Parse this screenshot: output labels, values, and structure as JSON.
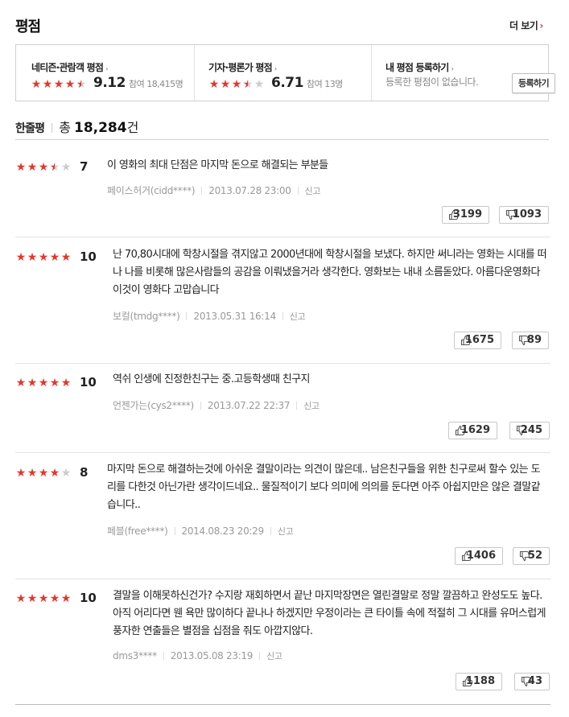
{
  "header": {
    "title": "평점",
    "more_label": "더 보기",
    "more_chevron": "›"
  },
  "summary": {
    "netizen": {
      "label": "네티즌·관람객 평점",
      "rating": 4.5,
      "score": "9.12",
      "participants": "참여 18,415명"
    },
    "critic": {
      "label": "기자·평론가 평점",
      "rating": 3.5,
      "score": "6.71",
      "participants": "참여 13명"
    },
    "mine": {
      "label": "내 평점 등록하기",
      "subtext": "등록한 평점이 없습니다.",
      "button_label": "등록하기"
    },
    "arrow": "›"
  },
  "review_count": {
    "label": "한줄평",
    "prefix": "총",
    "count": "18,284",
    "suffix": "건"
  },
  "report_label": "신고",
  "colors": {
    "accent": "#e0383b",
    "star_filled": "#e6362c",
    "star_empty": "#cccccc"
  },
  "reviews": [
    {
      "rating": 3.5,
      "score": "7",
      "text": "이 영화의 최대 단점은 마지막 돈으로 해결되는 부분들",
      "author": "페이스허거(cidd****)",
      "date": "2013.07.28 23:00",
      "likes": "3199",
      "dislikes": "1093"
    },
    {
      "rating": 5,
      "score": "10",
      "text": "난 70,80시대에 학창시절을 겪지않고 2000년대에 학창시절을 보냈다. 하지만 써니라는 영화는 시대를 떠나 나를 비롯해 많은사람들의 공감을 이뤄냈을거라 생각한다. 영화보는 내내 소름돋았다. 아름다운영화다 이것이 영화다 고맙습니다",
      "author": "보컬(tmdg****)",
      "date": "2013.05.31 16:14",
      "likes": "1675",
      "dislikes": "89"
    },
    {
      "rating": 5,
      "score": "10",
      "text": "역쉬 인생에 진정한친구는 중.고등학생때 친구지",
      "author": "언젠가는(cys2****)",
      "date": "2013.07.22 22:37",
      "likes": "1629",
      "dislikes": "245"
    },
    {
      "rating": 4,
      "score": "8",
      "text": "마지막 돈으로 해결하는것에 아쉬운 결말이라는 의견이 많은데.. 남은친구들을 위한 친구로써 할수 있는 도리를 다한것 아닌가란 생각이드네요.. 물질적이기 보다 의미에 의의를 둔다면 아주 아쉽지만은 않은 결말같습니다..",
      "author": "페블(free****)",
      "date": "2014.08.23 20:29",
      "likes": "1406",
      "dislikes": "52"
    },
    {
      "rating": 5,
      "score": "10",
      "text": "결말을 이해못하신건가? 수지랑 재회하면서 끝난 마지막장면은 열린결말로 정말 깔끔하고 완성도도 높다. 아직 어리다면 웬 욕만 많이하다 끝나나 하겠지만 우정이라는 큰 타이틀 속에 적절히 그 시대를 유머스럽게 풍자한 연출들은 별점을 십점을 줘도 아깝지않다.",
      "author": "dms3****",
      "date": "2013.05.08 23:19",
      "likes": "1188",
      "dislikes": "43"
    }
  ]
}
